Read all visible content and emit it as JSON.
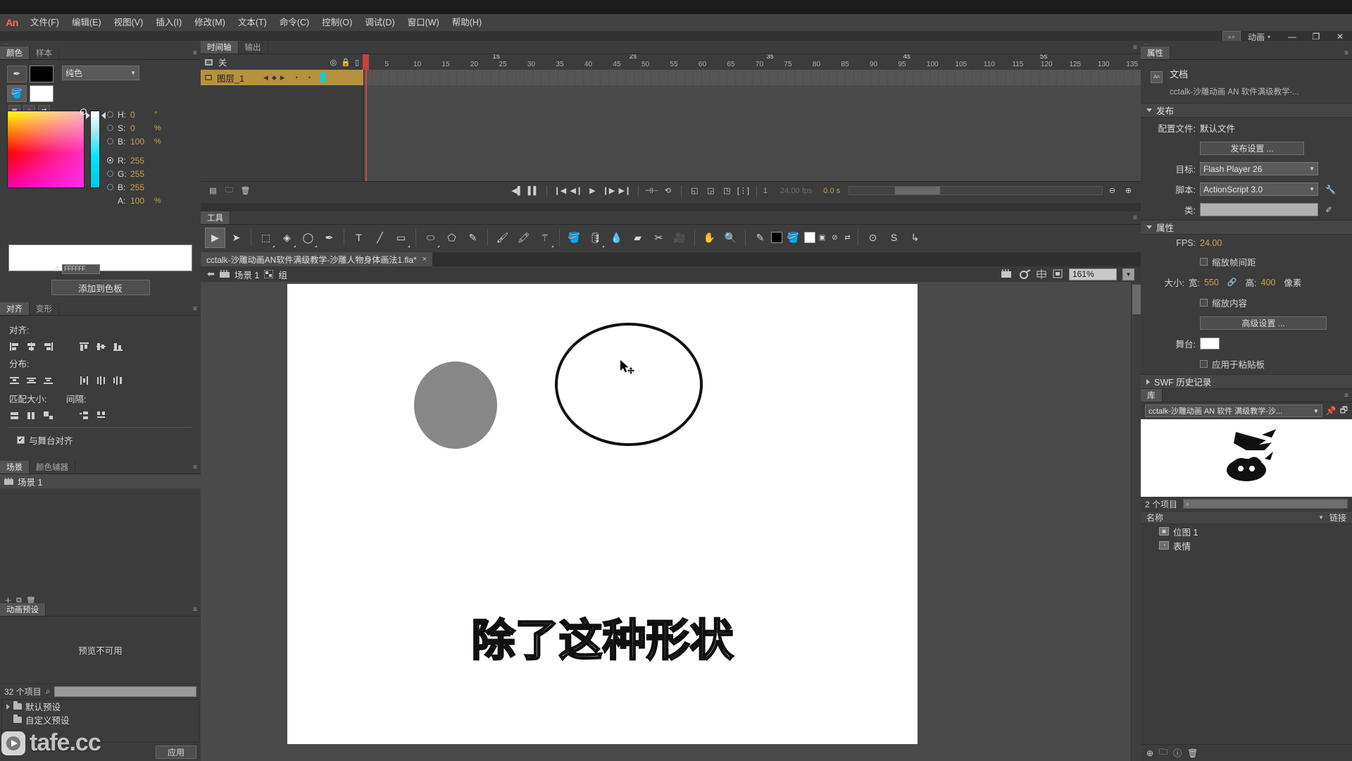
{
  "app": {
    "logo": "An",
    "workspace": "动画",
    "workspace_caret": "▾"
  },
  "menu": {
    "items": [
      {
        "label": "文件(F)"
      },
      {
        "label": "编辑(E)"
      },
      {
        "label": "视图(V)"
      },
      {
        "label": "插入(I)"
      },
      {
        "label": "修改(M)"
      },
      {
        "label": "文本(T)"
      },
      {
        "label": "命令(C)"
      },
      {
        "label": "控制(O)"
      },
      {
        "label": "调试(D)"
      },
      {
        "label": "窗口(W)"
      },
      {
        "label": "帮助(H)"
      }
    ]
  },
  "window_controls": {
    "minimize": "—",
    "restore": "❐",
    "close": "✕",
    "search_icon": "search-icon"
  },
  "color_panel": {
    "tabs": [
      {
        "label": "颜色",
        "active": true
      },
      {
        "label": "样本",
        "active": false
      }
    ],
    "fill_type": "纯色",
    "stroke_color": "#000000",
    "fill_color": "#ffffff",
    "fields": [
      {
        "label": "H:",
        "value": "0",
        "unit": "°",
        "selected": false
      },
      {
        "label": "S:",
        "value": "0",
        "unit": "%",
        "selected": false
      },
      {
        "label": "B:",
        "value": "100",
        "unit": "%",
        "selected": false
      },
      {
        "label": "R:",
        "value": "255",
        "unit": "",
        "selected": true
      },
      {
        "label": "G:",
        "value": "255",
        "unit": "",
        "selected": false
      },
      {
        "label": "B:",
        "value": "255",
        "unit": "",
        "selected": false
      },
      {
        "label": "A:",
        "value": "100",
        "unit": "%",
        "selected": false
      }
    ],
    "hex_label": "#",
    "hex_value": "FFFFFF",
    "add_swatch_button": "添加到色板"
  },
  "align_panel": {
    "tabs": [
      {
        "label": "对齐",
        "active": true
      },
      {
        "label": "变形",
        "active": false
      }
    ],
    "align_label": "对齐:",
    "distribute_label": "分布:",
    "match_size_label": "匹配大小:",
    "spacing_label": "间隔:",
    "align_to_stage_label": "与舞台对齐",
    "align_to_stage_checked": true
  },
  "scene_panel": {
    "tabs": [
      {
        "label": "场景",
        "active": true
      },
      {
        "label": "颜色辅器",
        "active": false
      }
    ],
    "items": [
      {
        "label": "场景 1"
      }
    ]
  },
  "motion_presets": {
    "tab": "动画预设",
    "preview_text": "预览不可用",
    "count": "32 个项目",
    "search_placeholder": "",
    "items": [
      {
        "label": "默认预设",
        "expandable": true
      },
      {
        "label": "自定义预设",
        "expandable": false
      }
    ],
    "apply_button": "应用"
  },
  "watermark": {
    "text": "tafe.cc"
  },
  "timeline": {
    "tabs": [
      {
        "label": "时间轴",
        "active": true
      },
      {
        "label": "输出",
        "active": false
      }
    ],
    "onion_label": "关",
    "layers": [
      {
        "name": "图层_1",
        "selected": true
      }
    ],
    "ruler_ticks": [
      "1",
      "5",
      "10",
      "15",
      "20",
      "25",
      "30",
      "35",
      "40",
      "45",
      "50",
      "55",
      "60",
      "65",
      "70",
      "75",
      "80",
      "85",
      "90",
      "95",
      "100",
      "105",
      "110",
      "115",
      "120",
      "125",
      "130",
      "1"
    ],
    "second_marks": [
      "1s",
      "2s",
      "3s",
      "4s",
      "5s"
    ],
    "current_frame": "1",
    "fps_label": "24.00 fps",
    "time_label": "0.0 s",
    "playhead_frame": 1
  },
  "toolbar": {
    "tab": "工具",
    "tools": [
      {
        "name": "selection-tool",
        "glyph": "▶",
        "active": true
      },
      {
        "name": "subselection-tool",
        "glyph": "➤",
        "active": false
      },
      {
        "name": "free-transform-tool",
        "glyph": "⬚",
        "active": false
      },
      {
        "name": "gradient-transform-tool",
        "glyph": "◈",
        "active": false
      },
      {
        "name": "lasso-tool",
        "glyph": "◯",
        "active": false
      },
      {
        "name": "pen-tool",
        "glyph": "✒",
        "active": false
      },
      {
        "name": "text-tool",
        "glyph": "T",
        "active": false
      },
      {
        "name": "line-tool",
        "glyph": "╱",
        "active": false
      },
      {
        "name": "rectangle-tool",
        "glyph": "▭",
        "active": false
      },
      {
        "name": "oval-tool",
        "glyph": "⬭",
        "active": false
      },
      {
        "name": "polystar-tool",
        "glyph": "⬠",
        "active": false
      },
      {
        "name": "pencil-tool",
        "glyph": "✎",
        "active": false
      },
      {
        "name": "brush-tool",
        "glyph": "🖌",
        "active": false
      },
      {
        "name": "paint-brush-tool",
        "glyph": "🖍",
        "active": false
      },
      {
        "name": "bone-tool",
        "glyph": "⚚",
        "active": false
      },
      {
        "name": "paint-bucket-tool",
        "glyph": "🪣",
        "active": false
      },
      {
        "name": "ink-bottle-tool",
        "glyph": "🛢",
        "active": false
      },
      {
        "name": "eyedropper-tool",
        "glyph": "💧",
        "active": false
      },
      {
        "name": "eraser-tool",
        "glyph": "▰",
        "active": false
      },
      {
        "name": "width-tool",
        "glyph": "✂",
        "active": false
      },
      {
        "name": "camera-tool",
        "glyph": "🎥",
        "active": false
      },
      {
        "name": "hand-tool",
        "glyph": "✋",
        "active": false
      },
      {
        "name": "zoom-tool",
        "glyph": "🔍",
        "active": false
      }
    ],
    "stroke_color": "#000000",
    "fill_color": "#ffffff"
  },
  "document": {
    "tab_title": "cctalk-沙雕动画AN软件满级教学-沙雕人物身体画法1.fla*",
    "tab_close": "×",
    "breadcrumb": [
      {
        "label": "场景 1",
        "icon": "scene-icon"
      },
      {
        "label": "组",
        "icon": "group-icon"
      }
    ],
    "zoom_level": "161%"
  },
  "stage": {
    "text": "除了这种形状",
    "shapes": [
      {
        "name": "filled-gray-circle",
        "fill": "#878787"
      },
      {
        "name": "outlined-circle",
        "stroke": "#111111"
      }
    ]
  },
  "properties": {
    "tab": "属性",
    "doc_title": "文档",
    "doc_name": "cctalk-沙雕动画 AN 软件满级教学-...",
    "publish_section": "发布",
    "profile_label": "配置文件:",
    "profile_value": "默认文件",
    "publish_settings_button": "发布设置 ...",
    "target_label": "目标:",
    "target_value": "Flash Player 26",
    "script_label": "脚本:",
    "script_value": "ActionScript 3.0",
    "class_label": "类:",
    "class_value": "",
    "attributes_section": "属性",
    "fps_label": "FPS:",
    "fps_value": "24.00",
    "scale_spacing_label": "缩放帧间距",
    "size_label": "大小:",
    "width_label": "宽:",
    "width_value": "550",
    "height_label": "高:",
    "height_value": "400",
    "unit_label": "像素",
    "scale_content_label": "缩放内容",
    "advanced_button": "高级设置 ...",
    "stage_label": "舞台:",
    "stage_color": "#ffffff",
    "apply_pasteboard_label": "应用于粘贴板",
    "swf_history_section": "SWF 历史记录"
  },
  "library": {
    "tab": "库",
    "doc_selector": "cctalk-沙雕动画 AN 软件 满级教学-沙...",
    "count": "2 个项目",
    "search_placeholder": "",
    "columns": [
      {
        "label": "名称"
      },
      {
        "label": "链接"
      }
    ],
    "items": [
      {
        "label": "位图 1",
        "icon": "bitmap-icon"
      },
      {
        "label": "表情",
        "icon": "graphic-icon"
      }
    ]
  }
}
